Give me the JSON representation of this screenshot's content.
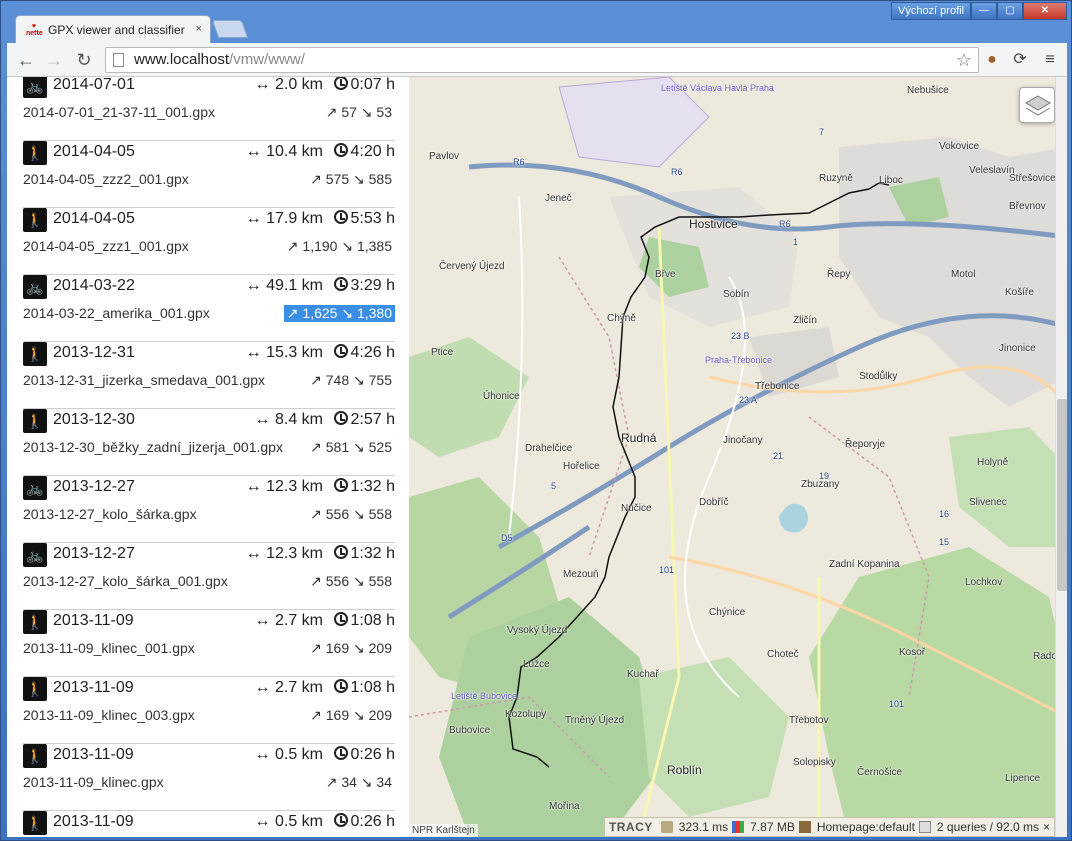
{
  "browser": {
    "tab_title": "GPX viewer and classifier",
    "favicon_text": "nette",
    "tab_close": "×",
    "profile_label": "Výchozí profil",
    "url_host": "www.localhost",
    "url_path": "/vmw/www/",
    "window_buttons": [
      "—",
      "▢",
      "✕"
    ]
  },
  "tracks": [
    {
      "activity": "bike",
      "date": "2014-07-01",
      "dist": "↔ 2.0 km",
      "time": "0:07 h",
      "file": "2014-07-01_21-37-11_001.gpx",
      "elev": "↗ 57 ↘ 53",
      "selected": false
    },
    {
      "activity": "walk",
      "date": "2014-04-05",
      "dist": "↔ 10.4 km",
      "time": "4:20 h",
      "file": "2014-04-05_zzz2_001.gpx",
      "elev": "↗ 575 ↘ 585",
      "selected": false
    },
    {
      "activity": "walk",
      "date": "2014-04-05",
      "dist": "↔ 17.9 km",
      "time": "5:53 h",
      "file": "2014-04-05_zzz1_001.gpx",
      "elev": "↗ 1,190 ↘ 1,385",
      "selected": false
    },
    {
      "activity": "bike",
      "date": "2014-03-22",
      "dist": "↔ 49.1 km",
      "time": "3:29 h",
      "file": "2014-03-22_amerika_001.gpx",
      "elev": "↗ 1,625 ↘ 1,380",
      "selected": true
    },
    {
      "activity": "walk",
      "date": "2013-12-31",
      "dist": "↔ 15.3 km",
      "time": "4:26 h",
      "file": "2013-12-31_jizerka_smedava_001.gpx",
      "elev": "↗ 748 ↘ 755",
      "selected": false
    },
    {
      "activity": "walk",
      "date": "2013-12-30",
      "dist": "↔ 8.4 km",
      "time": "2:57 h",
      "file": "2013-12-30_běžky_zadní_jizerja_001.gpx",
      "elev": "↗ 581 ↘ 525",
      "selected": false
    },
    {
      "activity": "bike",
      "date": "2013-12-27",
      "dist": "↔ 12.3 km",
      "time": "1:32 h",
      "file": "2013-12-27_kolo_šárka.gpx",
      "elev": "↗ 556 ↘ 558",
      "selected": false
    },
    {
      "activity": "bike",
      "date": "2013-12-27",
      "dist": "↔ 12.3 km",
      "time": "1:32 h",
      "file": "2013-12-27_kolo_šárka_001.gpx",
      "elev": "↗ 556 ↘ 558",
      "selected": false
    },
    {
      "activity": "walk",
      "date": "2013-11-09",
      "dist": "↔ 2.7 km",
      "time": "1:08 h",
      "file": "2013-11-09_klinec_001.gpx",
      "elev": "↗ 169 ↘ 209",
      "selected": false
    },
    {
      "activity": "walk",
      "date": "2013-11-09",
      "dist": "↔ 2.7 km",
      "time": "1:08 h",
      "file": "2013-11-09_klinec_003.gpx",
      "elev": "↗ 169 ↘ 209",
      "selected": false
    },
    {
      "activity": "walk",
      "date": "2013-11-09",
      "dist": "↔ 0.5 km",
      "time": "0:26 h",
      "file": "2013-11-09_klinec.gpx",
      "elev": "↗ 34 ↘ 34",
      "selected": false
    },
    {
      "activity": "walk",
      "date": "2013-11-09",
      "dist": "↔ 0.5 km",
      "time": "0:26 h",
      "file": "",
      "elev": "",
      "selected": false
    }
  ],
  "map": {
    "places": [
      "Nebušice",
      "Vokovice",
      "Veleslavín",
      "Ruzyně",
      "Liboc",
      "Střešovice",
      "Břevnov",
      "Pavlov",
      "Jeneč",
      "Hostivice",
      "Řepy",
      "Motol",
      "Košíře",
      "Červený Újezd",
      "Břve",
      "Sobín",
      "Chýně",
      "Zličín",
      "Jinonice",
      "Ptice",
      "Třebonice",
      "Stodůlky",
      "Úhonice",
      "Rudná",
      "Drahelčice",
      "Jinočany",
      "Řeporyje",
      "Holyně",
      "Hořelice",
      "Zbuzany",
      "Dobříč",
      "Slivenec",
      "Nučice",
      "Mezouň",
      "Zadní Kopanina",
      "Lochkov",
      "Chýnice",
      "Vysoký Újezd",
      "Choteč",
      "Kosoř",
      "Radotín",
      "Lužce",
      "Kuchař",
      "Trněný Újezd",
      "Třebotov",
      "Bubovice",
      "Kozolupy",
      "Solopisky",
      "Roblín",
      "Černošice",
      "Lipence",
      "Mořina",
      "Letiště Václava Havla Praha",
      "Letiště Bubovice",
      "Praha-Třebonice"
    ],
    "road_labels": [
      "R6",
      "R6",
      "R6",
      "D5",
      "101",
      "101",
      "7",
      "23 B",
      "23 A",
      "21",
      "19",
      "16",
      "15",
      "5",
      "1"
    ],
    "attribution": "NPR Karlštejn",
    "colors": {
      "land": "#eee9dd",
      "forest": "#add19e",
      "water": "#aad3df",
      "urban": "#e0dfdf",
      "highway": "#809bc0",
      "track": "#111111"
    }
  },
  "tracy": {
    "logo": "TRACY",
    "time": "323.1 ms",
    "memory": "7.87 MB",
    "route": "Homepage:default",
    "queries": "2 queries / 92.0 ms",
    "close": "×"
  }
}
